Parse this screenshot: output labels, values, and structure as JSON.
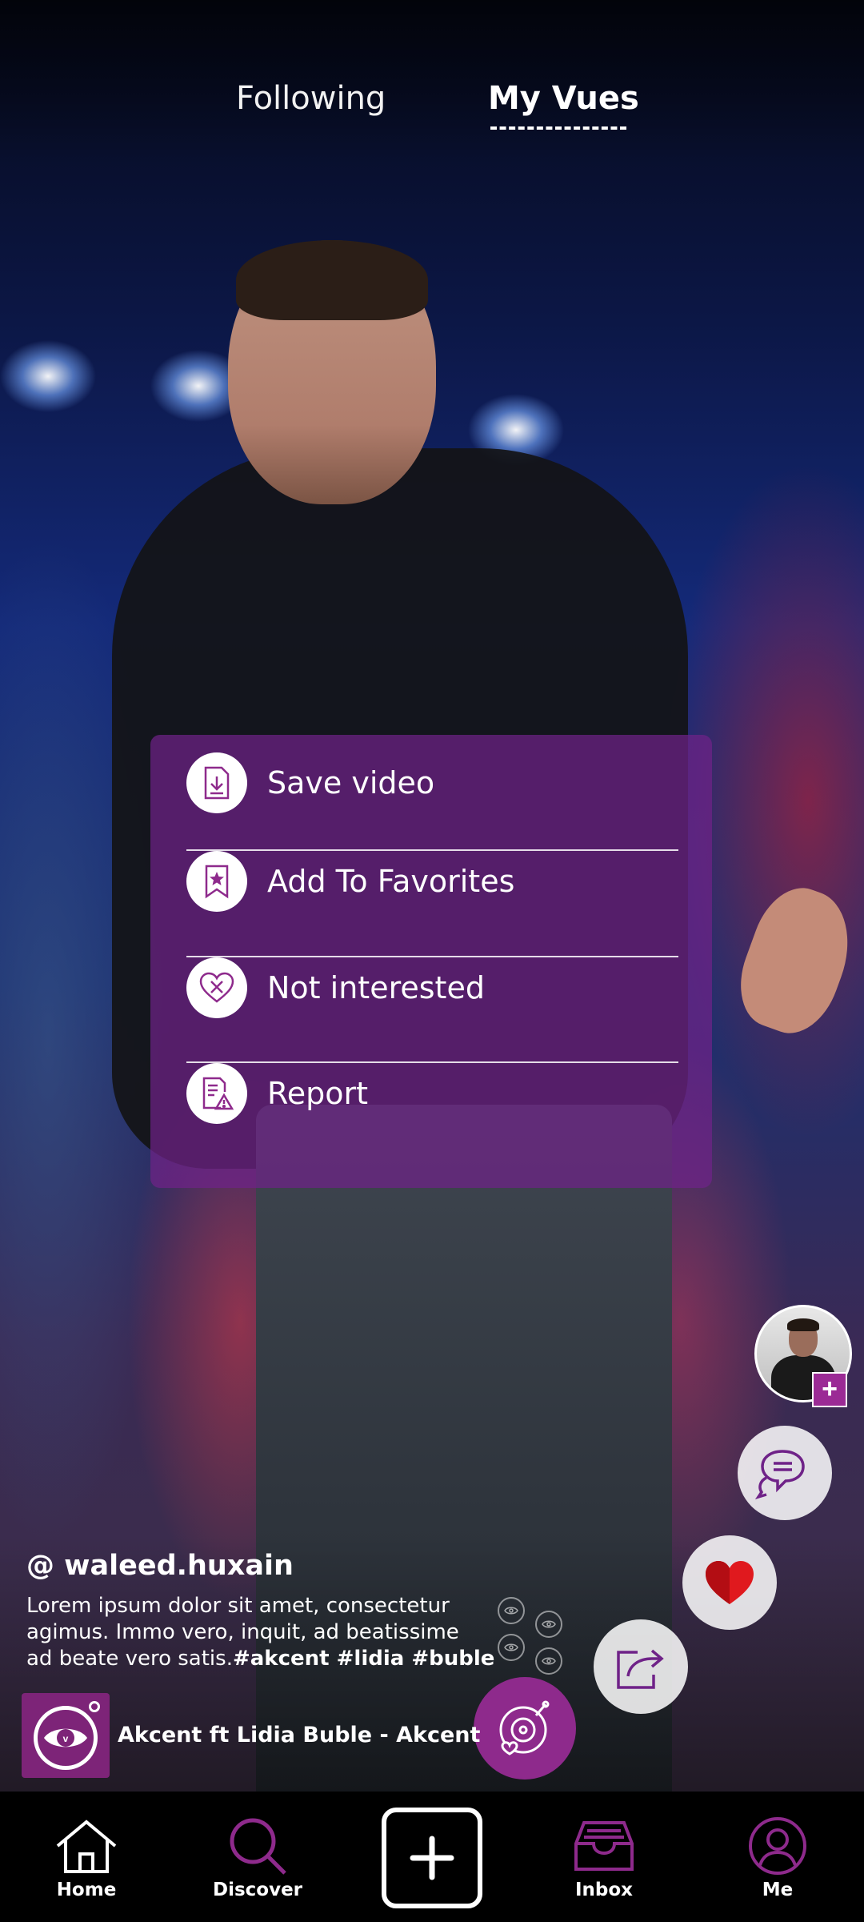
{
  "header": {
    "tabs": [
      {
        "label": "Following",
        "active": false
      },
      {
        "label": "My Vues",
        "active": true
      }
    ]
  },
  "menu": {
    "items": [
      {
        "label": "Save video",
        "icon": "save-video-icon"
      },
      {
        "label": "Add To Favorites",
        "icon": "bookmark-star-icon"
      },
      {
        "label": "Not interested",
        "icon": "heart-x-icon"
      },
      {
        "label": "Report",
        "icon": "report-warning-icon"
      }
    ]
  },
  "post": {
    "handle": "@ waleed.huxain",
    "caption_line1": "Lorem ipsum dolor sit amet, consectetur",
    "caption_line2": "agimus. Immo vero, inquit, ad beatissime",
    "caption_line3": "ad beate vero satis.",
    "hashtags": "#akcent #lidia #buble",
    "song": "Akcent ft Lidia Buble - Akcent"
  },
  "actions": {
    "follow_badge": "+",
    "icons": [
      "avatar",
      "comment-icon",
      "heart-icon",
      "share-icon",
      "music-disc-icon"
    ]
  },
  "nav": {
    "items": [
      {
        "label": "Home",
        "icon": "home-icon"
      },
      {
        "label": "Discover",
        "icon": "search-icon"
      },
      {
        "label": "",
        "icon": "plus-icon"
      },
      {
        "label": "Inbox",
        "icon": "inbox-icon"
      },
      {
        "label": "Me",
        "icon": "profile-icon"
      }
    ]
  },
  "colors": {
    "accent": "#8e2a8c",
    "menu_bg": "#6f2288",
    "like_red": "#e0191e",
    "navbar": "#000000"
  }
}
